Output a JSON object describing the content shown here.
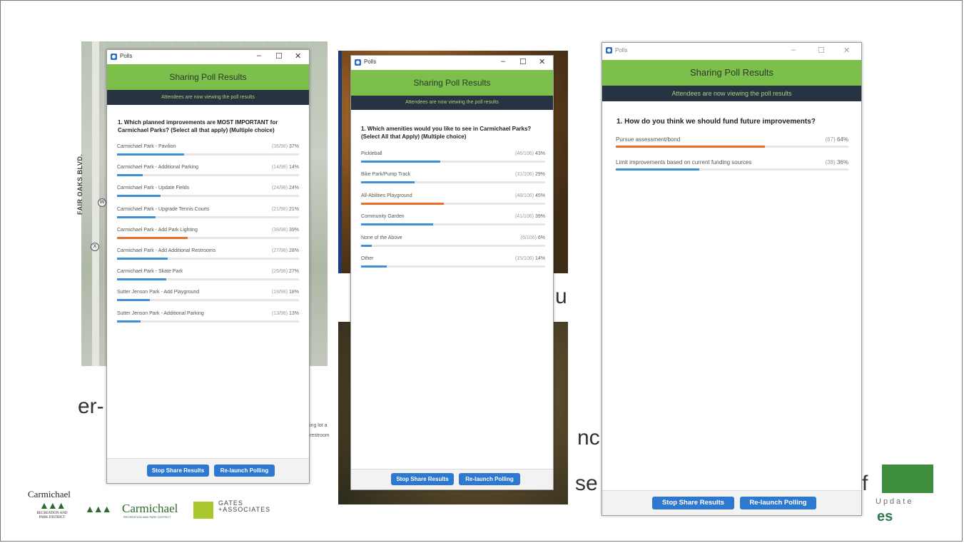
{
  "background": {
    "map_street_label": "FAIR OAKS BLVD.",
    "map_markers": [
      "W",
      "X"
    ],
    "fragment_er": "er-",
    "fragment_u": "u",
    "fragment_nc": "nc",
    "fragment_se": "se",
    "fragment_f": "f",
    "fragment_small_1": "ing lot a",
    "fragment_small_2": "restroom",
    "logos": {
      "carmichael_word": "Carmichael",
      "recreation_sub": "RECREATION AND PARK DISTRICT",
      "carmichael_script": "Carmichael",
      "carmichael_script_sub": "RECREATION AND PARK DISTRICT",
      "gates": "GATES\n+ASSOCIATES",
      "update": "Update",
      "es": "es"
    }
  },
  "windows": [
    {
      "window_title": "Polls",
      "header": "Sharing Poll Results",
      "subheader": "Attendees are now viewing the poll results",
      "question": "1. Which planned improvements are MOST IMPORTANT for Carmichael Parks? (Select all that apply) (Multiple choice)",
      "items": [
        {
          "label": "Carmichael Park - Pavilion",
          "count": "(36/98)",
          "pct": "37%",
          "value": 0.37,
          "highlight": false
        },
        {
          "label": "Carmichael Park - Additional Parking",
          "count": "(14/98)",
          "pct": "14%",
          "value": 0.14,
          "highlight": false
        },
        {
          "label": "Carmichael Park - Update Fields",
          "count": "(24/98)",
          "pct": "24%",
          "value": 0.24,
          "highlight": false
        },
        {
          "label": "Carmichael Park - Upgrade Tennis Courts",
          "count": "(21/98)",
          "pct": "21%",
          "value": 0.21,
          "highlight": false
        },
        {
          "label": "Carmichael Park - Add Park Lighting",
          "count": "(38/98)",
          "pct": "39%",
          "value": 0.39,
          "highlight": true
        },
        {
          "label": "Carmichael Park - Add Additional Restrooms",
          "count": "(27/98)",
          "pct": "28%",
          "value": 0.28,
          "highlight": false
        },
        {
          "label": "Carmichael Park - Skate Park",
          "count": "(26/98)",
          "pct": "27%",
          "value": 0.27,
          "highlight": false
        },
        {
          "label": "Sutter Jenson Park - Add Playground",
          "count": "(18/98)",
          "pct": "18%",
          "value": 0.18,
          "highlight": false
        },
        {
          "label": "Sutter Jenson Park - Additional Parking",
          "count": "(13/98)",
          "pct": "13%",
          "value": 0.13,
          "highlight": false
        }
      ],
      "stop_label": "Stop Share Results",
      "relaunch_label": "Re-launch Polling"
    },
    {
      "window_title": "Polls",
      "header": "Sharing Poll Results",
      "subheader": "Attendees are now viewing the poll results",
      "question": "1. Which amenities would you like to see in Carmichael Parks? (Select All that Apply) (Multiple choice)",
      "items": [
        {
          "label": "Pickleball",
          "count": "(46/106)",
          "pct": "43%",
          "value": 0.43,
          "highlight": false
        },
        {
          "label": "Bike Park/Pump Track",
          "count": "(31/106)",
          "pct": "29%",
          "value": 0.29,
          "highlight": false
        },
        {
          "label": "All-Abilities Playground",
          "count": "(48/106)",
          "pct": "45%",
          "value": 0.45,
          "highlight": true
        },
        {
          "label": "Community Garden",
          "count": "(41/106)",
          "pct": "39%",
          "value": 0.39,
          "highlight": false
        },
        {
          "label": "None of the Above",
          "count": "(6/106)",
          "pct": "6%",
          "value": 0.06,
          "highlight": false
        },
        {
          "label": "Other",
          "count": "(15/106)",
          "pct": "14%",
          "value": 0.14,
          "highlight": false
        }
      ],
      "stop_label": "Stop Share Results",
      "relaunch_label": "Re-launch Polling"
    },
    {
      "window_title": "Polls",
      "header": "Sharing Poll Results",
      "subheader": "Attendees are now viewing the poll results",
      "question": "1. How do you think we should fund future improvements?",
      "items": [
        {
          "label": "Pursue assessment/bond",
          "count": "(67)",
          "pct": "64%",
          "value": 0.64,
          "highlight": true
        },
        {
          "label": "Limit improvements based on current funding sources",
          "count": "(38)",
          "pct": "36%",
          "value": 0.36,
          "highlight": false
        }
      ],
      "stop_label": "Stop Share Results",
      "relaunch_label": "Re-launch Polling"
    }
  ]
}
